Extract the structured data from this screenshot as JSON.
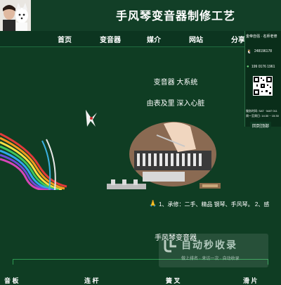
{
  "header": {
    "title": "手风琴变音器制修工艺"
  },
  "nav": {
    "items": [
      "首页",
      "变音器",
      "媒介",
      "网站",
      "分享"
    ]
  },
  "info_card": {
    "title": "金帝自强 · 名师老修",
    "qq": "248196178",
    "phone": "199  0176  1961",
    "footer_line1": "服务时间: SAT · MAT 011",
    "footer_line2": "周一至周日: 14:30 ~ 15:30",
    "scroll_top": "回到顶部"
  },
  "hero": {
    "tagline1": "变音器  大系统",
    "tagline2": "由表及里  深入心脏"
  },
  "service_strip": "1、承修：二手、精品 钢琴、手风琴。    2、感",
  "section": {
    "heading": "手风琴变音器",
    "tabs": [
      "音  板",
      "连  杆",
      "簧  叉",
      "滑  片"
    ]
  },
  "watermark": {
    "main": "自动秒收录",
    "sub": "做上排名 · 来访一次 · 自动收录"
  },
  "icons": {
    "qq": "qq-icon",
    "wechat": "wechat-icon",
    "service": "prayer-icon",
    "bird": "bird-icon"
  },
  "colors": {
    "background": "#0f3d23",
    "accent_line": "#2e9a52",
    "nav_bg": "#0c3520"
  }
}
